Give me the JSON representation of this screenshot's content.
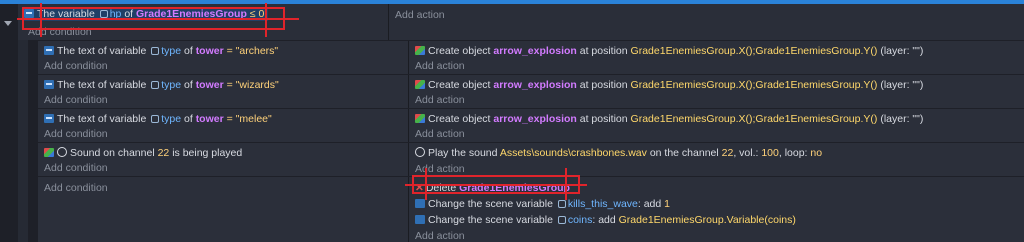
{
  "top_event": {
    "condition": {
      "prefix": "The variable",
      "var_icon": "variable-icon",
      "var_name": "hp",
      "of": "of",
      "object": "Grade1EnemiesGroup",
      "op": "≤",
      "value": "0"
    },
    "add_condition": "Add condition",
    "add_action": "Add action"
  },
  "sub_events": [
    {
      "condition": {
        "prefix": "The text of variable",
        "var_name": "type",
        "of": "of",
        "object": "tower",
        "eq": "=",
        "value": "\"archers\""
      },
      "add_condition": "Add condition",
      "action": {
        "label": "Create object",
        "object": "arrow_explosion",
        "mid": "at position",
        "pos": "Grade1EnemiesGroup.X();Grade1EnemiesGroup.Y()",
        "layer": "(layer: \"\")"
      },
      "add_action": "Add action"
    },
    {
      "condition": {
        "prefix": "The text of variable",
        "var_name": "type",
        "of": "of",
        "object": "tower",
        "eq": "=",
        "value": "\"wizards\""
      },
      "add_condition": "Add condition",
      "action": {
        "label": "Create object",
        "object": "arrow_explosion",
        "mid": "at position",
        "pos": "Grade1EnemiesGroup.X();Grade1EnemiesGroup.Y()",
        "layer": "(layer: \"\")"
      },
      "add_action": "Add action"
    },
    {
      "condition": {
        "prefix": "The text of variable",
        "var_name": "type",
        "of": "of",
        "object": "tower",
        "eq": "=",
        "value": "\"melee\""
      },
      "add_condition": "Add condition",
      "action": {
        "label": "Create object",
        "object": "arrow_explosion",
        "mid": "at position",
        "pos": "Grade1EnemiesGroup.X();Grade1EnemiesGroup.Y()",
        "layer": "(layer: \"\")"
      },
      "add_action": "Add action"
    }
  ],
  "sound_event": {
    "condition": {
      "prefix": "Sound on channel",
      "channel": "22",
      "suffix": "is being played"
    },
    "add_condition": "Add condition",
    "action": {
      "label": "Play the sound",
      "path": "Assets\\sounds\\crashbones.wav",
      "mid": "on the channel",
      "channel": "22",
      "vol_label": ", vol.:",
      "vol": "100",
      "loop_label": ", loop:",
      "loop": "no"
    },
    "add_action": "Add action"
  },
  "delete_event": {
    "add_condition": "Add condition",
    "actions": [
      {
        "label": "Delete",
        "object": "Grade1EnemiesGroup"
      },
      {
        "label": "Change the scene variable",
        "var": "kills_this_wave",
        "op": ": add",
        "value": "1"
      },
      {
        "label": "Change the scene variable",
        "var": "coins",
        "op": ": add",
        "value": "Grade1EnemiesGroup.Variable(coins)"
      }
    ],
    "add_action": "Add action"
  },
  "colors": {
    "accent": "#2a82d8",
    "highlight_red": "#e0242b",
    "object_purple": "#d27bff",
    "variable_blue": "#6fb6ff"
  }
}
